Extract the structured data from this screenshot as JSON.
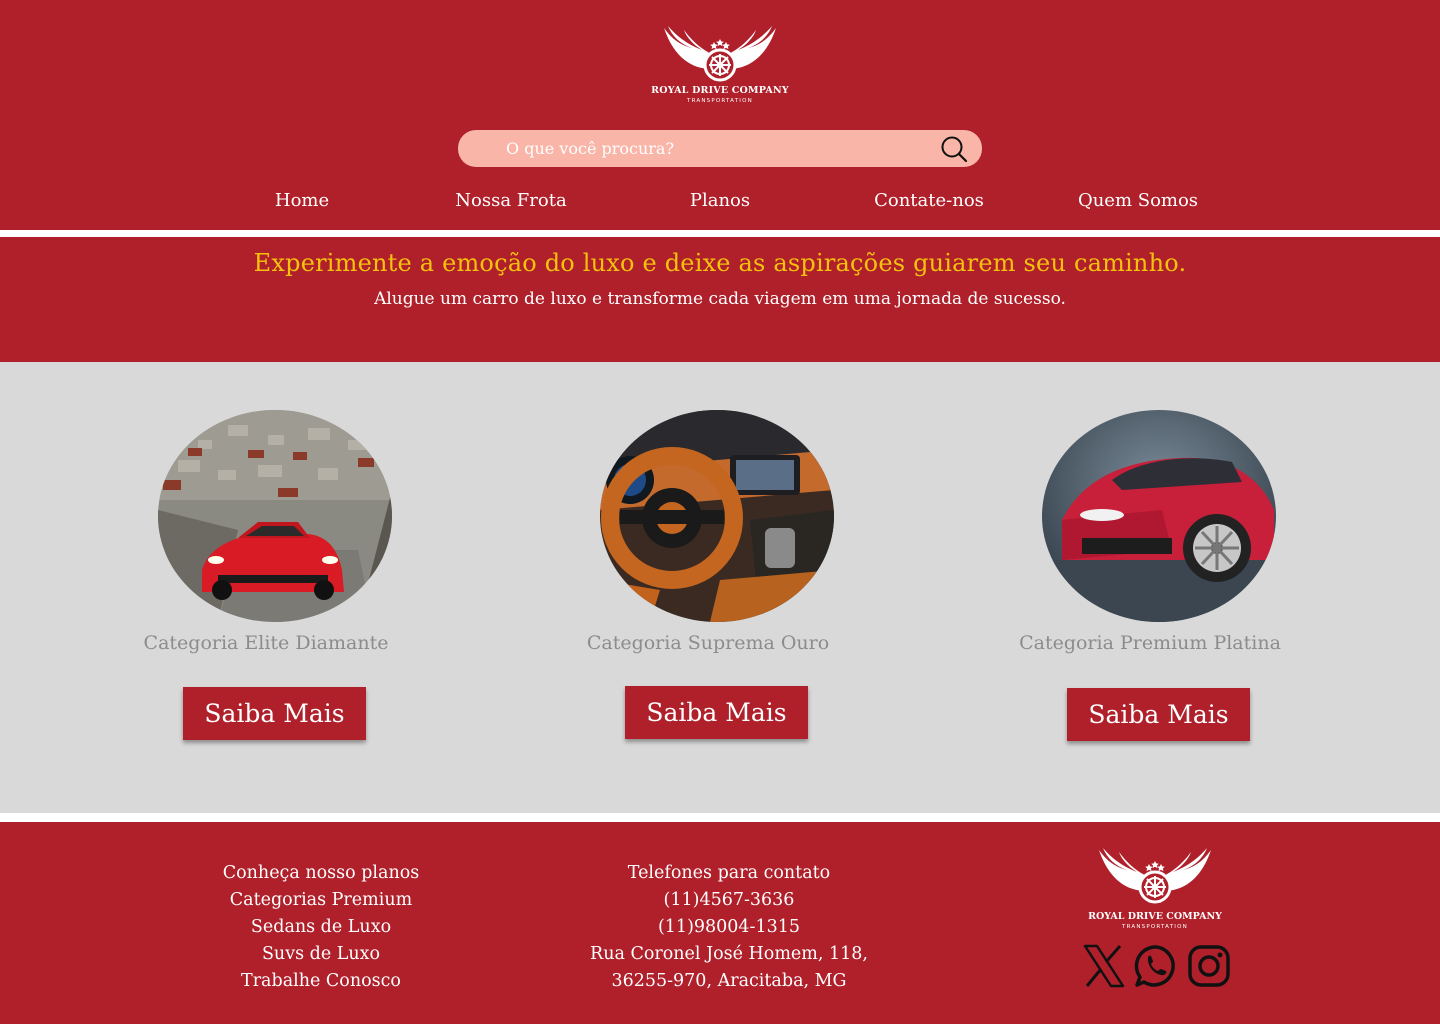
{
  "brand": {
    "name": "ROYAL DRIVE COMPANY",
    "tagline": "TRANSPORTATION"
  },
  "search": {
    "placeholder": "O que você procura?"
  },
  "nav": {
    "items": [
      {
        "label": "Home"
      },
      {
        "label": "Nossa Frota"
      },
      {
        "label": "Planos"
      },
      {
        "label": "Contate-nos"
      },
      {
        "label": "Quem Somos"
      }
    ]
  },
  "banner": {
    "headline": "Experimente a emoção do luxo e deixe as aspirações guiarem seu caminho.",
    "subheadline": "Alugue um carro de luxo e transforme cada viagem em uma jornada de sucesso."
  },
  "categories": [
    {
      "title": "Categoria Elite Diamante",
      "button": "Saiba Mais"
    },
    {
      "title": "Categoria Suprema Ouro",
      "button": "Saiba Mais"
    },
    {
      "title": "Categoria Premium Platina",
      "button": "Saiba Mais"
    }
  ],
  "footer": {
    "links": [
      "Conheça nosso planos",
      "Categorias Premium",
      "Sedans de Luxo",
      "Suvs de Luxo",
      "Trabalhe Conosco"
    ],
    "contact": {
      "title": "Telefones para contato",
      "phone1": "(11)4567-3636",
      "phone2": "(11)98004-1315",
      "address1": "Rua Coronel José Homem, 118,",
      "address2": "36255-970, Aracitaba, MG"
    },
    "social": [
      "x-icon",
      "whatsapp-icon",
      "instagram-icon"
    ]
  },
  "colors": {
    "primary": "#b0202b",
    "accent": "#f4c20d",
    "search_bg": "#f9b5a8",
    "section_bg": "#d9d9d9",
    "category_text": "#8c8c8c"
  }
}
